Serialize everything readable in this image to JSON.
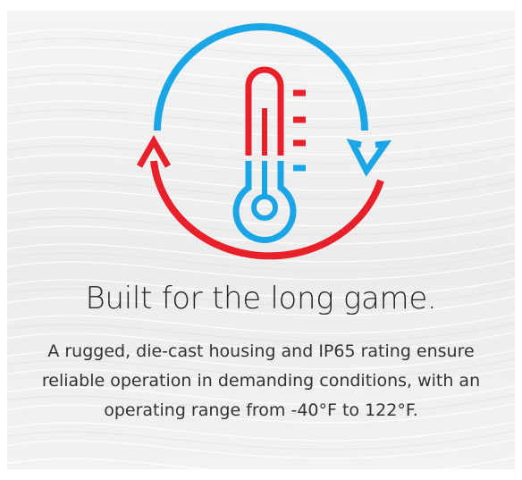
{
  "headline": "Built for the long game.",
  "body": "A rugged, die-cast housing and IP65 rating ensure reliable operation in demanding conditions, with an operating range from -40°F to 122°F.",
  "icon": {
    "name": "thermometer-cycle-icon",
    "colors": {
      "hot": "#e8202a",
      "cold": "#1aa6e6"
    }
  }
}
